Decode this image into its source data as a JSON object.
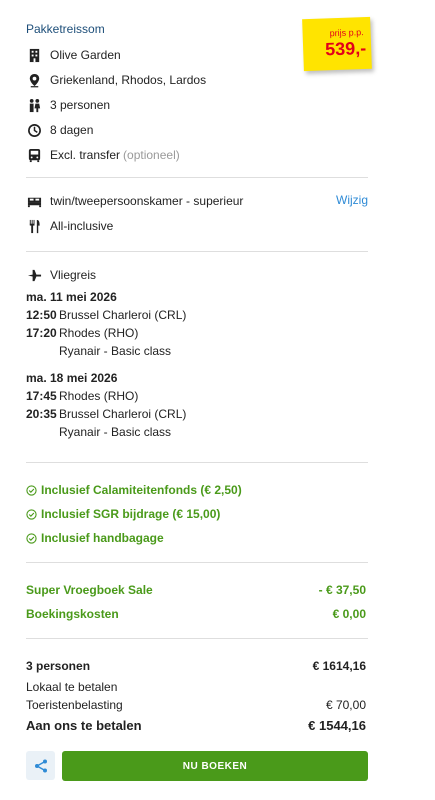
{
  "section_title": "Pakketreissom",
  "price_sticker": {
    "label": "prijs p.p.",
    "price": "539,-"
  },
  "details": [
    {
      "icon": "building-icon",
      "text": "Olive Garden"
    },
    {
      "icon": "location-pin-icon",
      "text": "Griekenland, Rhodos, Lardos"
    },
    {
      "icon": "persons-icon",
      "text": "3 personen"
    },
    {
      "icon": "clock-icon",
      "text": "8 dagen"
    },
    {
      "icon": "bus-icon",
      "text": "Excl. transfer",
      "extra": "(optioneel)"
    }
  ],
  "room": {
    "icon": "bed-icon",
    "text": "twin/tweepersoonskamer - superieur",
    "change_label": "Wijzig"
  },
  "board": {
    "icon": "cutlery-icon",
    "text": "All-inclusive"
  },
  "flight": {
    "icon": "plane-icon",
    "label": "Vliegreis",
    "outbound": {
      "date": "ma. 11 mei 2026",
      "dep_time": "12:50",
      "dep_airport": "Brussel Charleroi (CRL)",
      "arr_time": "17:20",
      "arr_airport": "Rhodes (RHO)",
      "carrier": "Ryanair - Basic class"
    },
    "return": {
      "date": "ma. 18 mei 2026",
      "dep_time": "17:45",
      "dep_airport": "Rhodes (RHO)",
      "arr_time": "20:35",
      "arr_airport": "Brussel Charleroi (CRL)",
      "carrier": "Ryanair - Basic class"
    }
  },
  "inclusions": [
    "Inclusief Calamiteitenfonds (€ 2,50)",
    "Inclusief SGR bijdrage (€ 15,00)",
    "Inclusief handbagage"
  ],
  "discounts": [
    {
      "label": "Super Vroegboek Sale",
      "amount": "- € 37,50"
    },
    {
      "label": "Boekingskosten",
      "amount": "€ 0,00"
    }
  ],
  "totals": {
    "persons_label": "3 personen",
    "persons_amount": "€ 1614,16",
    "local_label": "Lokaal te betalen",
    "tax_label": "Toeristenbelasting",
    "tax_amount": "€ 70,00",
    "pay_label": "Aan ons te betalen",
    "pay_amount": "€ 1544,16"
  },
  "actions": {
    "share_icon": "share-icon",
    "book_label": "NU BOEKEN"
  },
  "colors": {
    "green": "#4a9a1a",
    "link": "#2f8bd6",
    "title": "#1d4e79",
    "sticker": "#ffe400",
    "sticker_text": "#e2001a"
  }
}
